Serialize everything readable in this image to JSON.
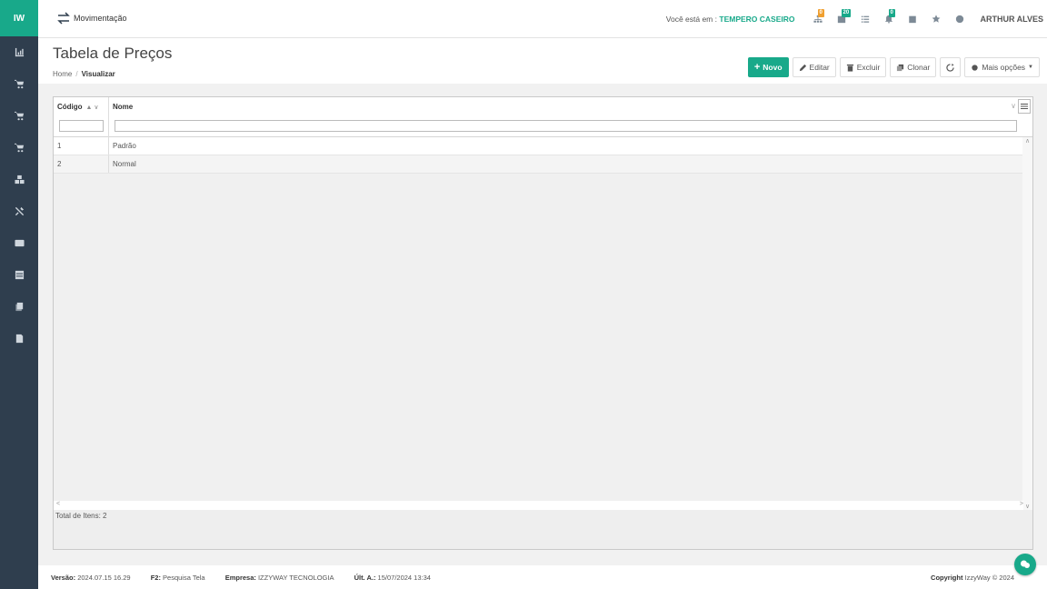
{
  "sidebar": {
    "logo": "IW",
    "items": [
      {
        "icon": "chart-icon",
        "name": "sidebar-item-dashboard"
      },
      {
        "icon": "cart-icon",
        "name": "sidebar-item-sales"
      },
      {
        "icon": "cart-icon",
        "name": "sidebar-item-purchases"
      },
      {
        "icon": "cart-icon",
        "name": "sidebar-item-orders"
      },
      {
        "icon": "cubes-icon",
        "name": "sidebar-item-stock"
      },
      {
        "icon": "tools-icon",
        "name": "sidebar-item-services"
      },
      {
        "icon": "card-icon",
        "name": "sidebar-item-finance"
      },
      {
        "icon": "table-icon",
        "name": "sidebar-item-tables"
      },
      {
        "icon": "copy-icon",
        "name": "sidebar-item-documents"
      },
      {
        "icon": "file-icon",
        "name": "sidebar-item-reports"
      }
    ]
  },
  "topbar": {
    "module_label": "Movimentação",
    "location_prefix": "Você está em :",
    "location_name": "TEMPERO CASEIRO",
    "badges": {
      "sitemap": "0",
      "calendar": "20",
      "bell": "0"
    },
    "user": "ARTHUR ALVES"
  },
  "header": {
    "title": "Tabela de Preços",
    "breadcrumb_home": "Home",
    "breadcrumb_sep": "/",
    "breadcrumb_current": "Visualizar"
  },
  "actions": {
    "new": "Novo",
    "edit": "Editar",
    "delete": "Excluir",
    "clone": "Clonar",
    "more": "Mais opções"
  },
  "grid": {
    "columns": [
      "Código",
      "Nome"
    ],
    "rows": [
      {
        "code": "1",
        "name": "Padrão"
      },
      {
        "code": "2",
        "name": "Normal"
      }
    ],
    "total_label": "Total de Itens: 2"
  },
  "footer": {
    "version_label": "Versão:",
    "version": "2024.07.15 16.29",
    "f2_label": "F2:",
    "f2_value": "Pesquisa Tela",
    "company_label": "Empresa:",
    "company": "IZZYWAY TECNOLOGIA",
    "last_label": "Últ. A.:",
    "last": "15/07/2024 13:34",
    "copyright_label": "Copyright",
    "copyright": "IzzyWay © 2024"
  },
  "colors": {
    "accent": "#18a98a",
    "sidebar": "#2f3e4e",
    "badge_orange": "#f0a030"
  }
}
